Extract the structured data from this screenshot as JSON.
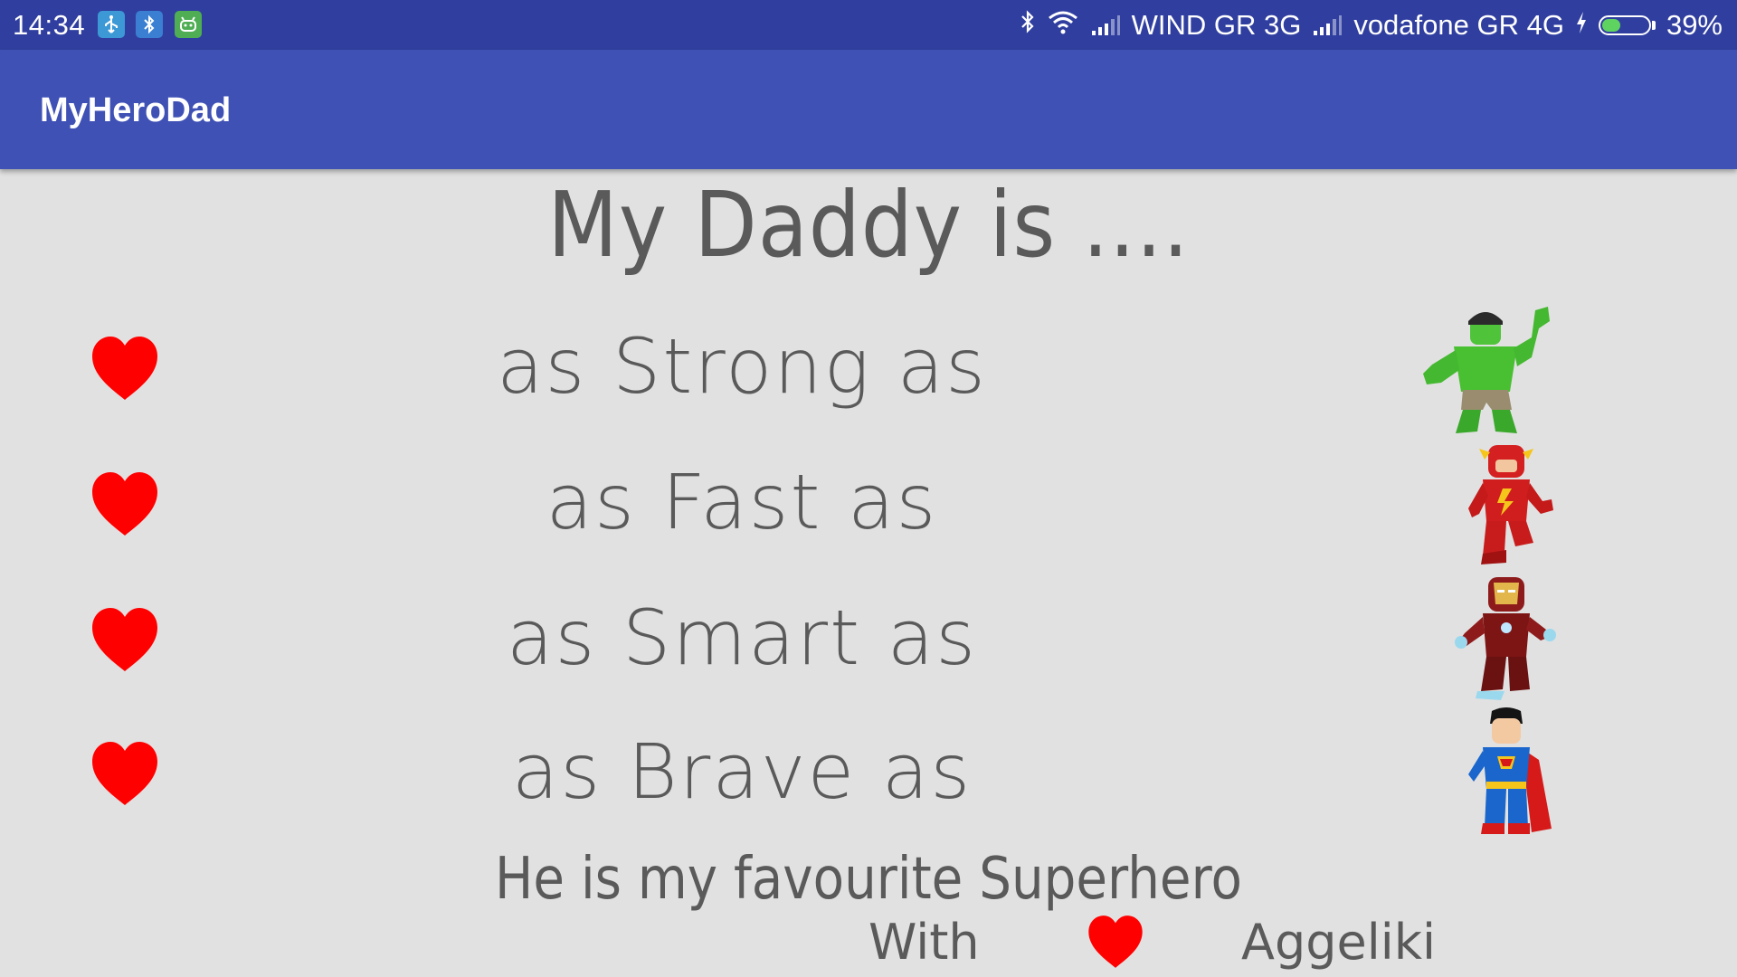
{
  "status_bar": {
    "time": "14:34",
    "notification_icons": [
      "usb-icon",
      "bluetooth-icon",
      "android-icon"
    ],
    "carrier1": "WIND GR 3G",
    "carrier2": "vodafone GR 4G",
    "battery_percent_label": "39%",
    "battery_level": 0.39,
    "colors": {
      "background": "#303f9f",
      "battery_fill": "#5fd35f"
    }
  },
  "app_bar": {
    "title": "MyHeroDad",
    "color": "#3f51b5"
  },
  "content": {
    "headline": "My Daddy is ....",
    "rows": [
      {
        "text": "as Strong as",
        "icon": "heart-icon",
        "hero": "hulk-figure"
      },
      {
        "text": "as Fast as",
        "icon": "heart-icon",
        "hero": "flash-figure"
      },
      {
        "text": "as Smart as",
        "icon": "heart-icon",
        "hero": "iron-man-figure"
      },
      {
        "text": "as Brave as",
        "icon": "heart-icon",
        "hero": "superman-figure"
      }
    ],
    "tagline": "He is my favourite Superhero",
    "signature_prefix": "With",
    "signature_icon": "heart-icon",
    "signature_name": "Aggeliki",
    "colors": {
      "text": "#5a5a5a",
      "heart": "#ff0000",
      "background": "#e1e1e1"
    }
  }
}
